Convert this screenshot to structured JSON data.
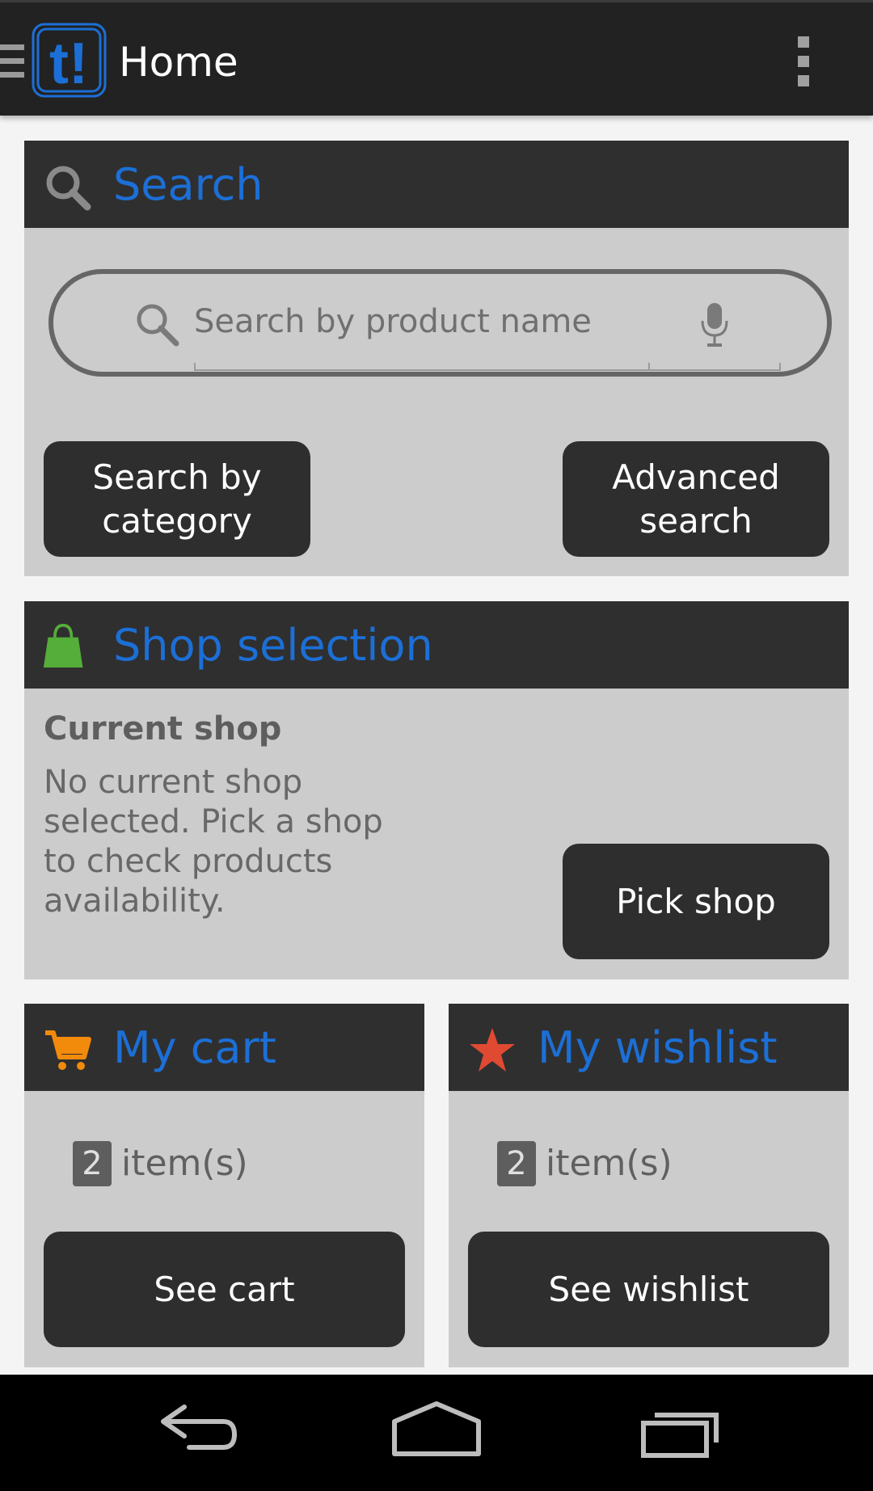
{
  "actionbar": {
    "title": "Home",
    "logo_text": "t!",
    "drawer_icon": "hamburger-menu-icon",
    "overflow_icon": "overflow-menu-icon"
  },
  "search_card": {
    "title": "Search",
    "icon": "search-icon",
    "input_placeholder": "Search by product name",
    "mic_icon": "microphone-icon",
    "btn_category": "Search by category",
    "btn_advanced": "Advanced search"
  },
  "shop_card": {
    "title": "Shop selection",
    "icon": "shopping-bag-icon",
    "current_label": "Current shop",
    "description": "No current shop selected. Pick a shop to check products availability.",
    "btn_pick": "Pick shop"
  },
  "cart_card": {
    "title": "My cart",
    "icon": "cart-icon",
    "count": "2",
    "count_label": "item(s)",
    "btn": "See cart"
  },
  "wishlist_card": {
    "title": "My wishlist",
    "icon": "star-icon",
    "count": "2",
    "count_label": "item(s)",
    "btn": "See wishlist"
  },
  "navbar": {
    "back_icon": "back-icon",
    "home_icon": "home-icon",
    "recents_icon": "recent-apps-icon"
  },
  "colors": {
    "accent": "#1c6fd6",
    "cart_icon": "#f28a0c",
    "bag_icon": "#55ad3a",
    "star_icon": "#e04a32",
    "header_bg": "#2f2f2f",
    "card_bg": "#cccccc"
  }
}
